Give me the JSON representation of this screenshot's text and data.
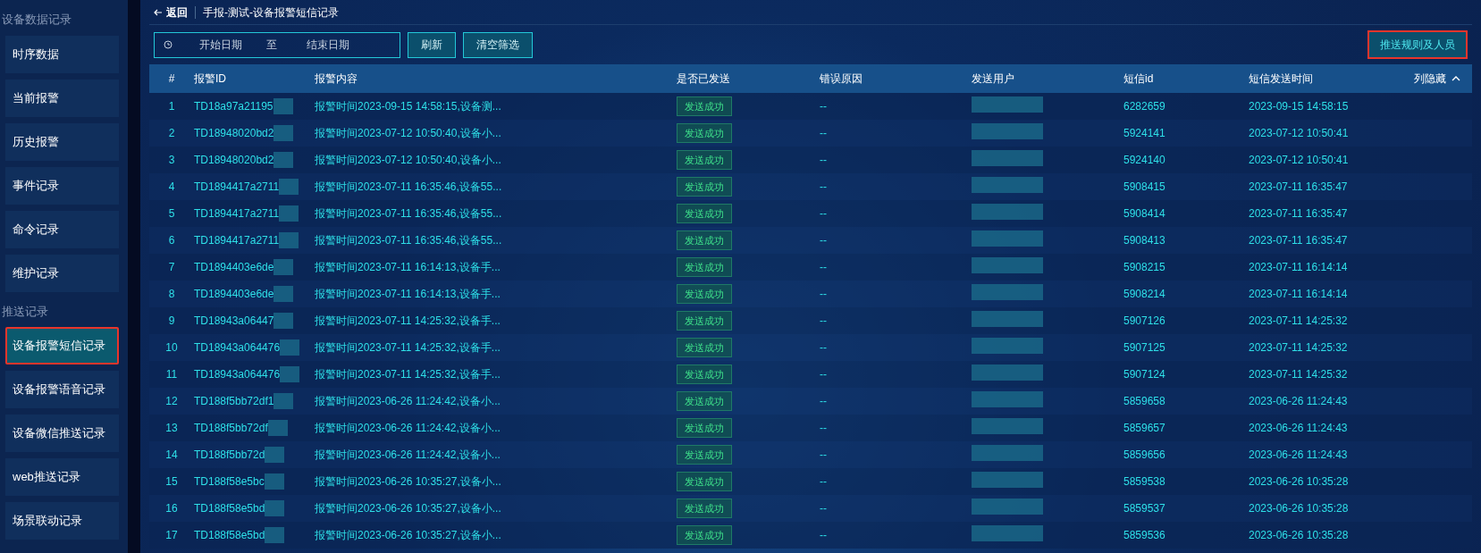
{
  "sidebar": {
    "sections": [
      {
        "title": "设备数据记录",
        "items": [
          {
            "label": "时序数据",
            "selected": false
          },
          {
            "label": "当前报警",
            "selected": false
          },
          {
            "label": "历史报警",
            "selected": false
          },
          {
            "label": "事件记录",
            "selected": false
          },
          {
            "label": "命令记录",
            "selected": false
          },
          {
            "label": "维护记录",
            "selected": false
          }
        ]
      },
      {
        "title": "推送记录",
        "items": [
          {
            "label": "设备报警短信记录",
            "selected": true
          },
          {
            "label": "设备报警语音记录",
            "selected": false
          },
          {
            "label": "设备微信推送记录",
            "selected": false
          },
          {
            "label": "web推送记录",
            "selected": false
          },
          {
            "label": "场景联动记录",
            "selected": false
          }
        ]
      }
    ]
  },
  "header": {
    "back": "返回",
    "breadcrumb": "手报-测试-设备报警短信记录"
  },
  "filters": {
    "start_placeholder": "开始日期",
    "separator": "至",
    "end_placeholder": "结束日期",
    "buttons": [
      "刷新",
      "清空筛选"
    ],
    "action": "推送规则及人员"
  },
  "table": {
    "columns": [
      "#",
      "报警ID",
      "报警内容",
      "是否已发送",
      "错误原因",
      "发送用户",
      "短信id",
      "短信发送时间"
    ],
    "column_toggle": "列隐藏",
    "rows": [
      {
        "index": "1",
        "alarm_id": "TD18a97a21195",
        "content": "报警时间2023-09-15 14:58:15,设备测...",
        "status": "发送成功",
        "error": "--",
        "sms_id": "6282659",
        "time": "2023-09-15 14:58:15"
      },
      {
        "index": "2",
        "alarm_id": "TD18948020bd2",
        "content": "报警时间2023-07-12 10:50:40,设备小...",
        "status": "发送成功",
        "error": "--",
        "sms_id": "5924141",
        "time": "2023-07-12 10:50:41"
      },
      {
        "index": "3",
        "alarm_id": "TD18948020bd2",
        "content": "报警时间2023-07-12 10:50:40,设备小...",
        "status": "发送成功",
        "error": "--",
        "sms_id": "5924140",
        "time": "2023-07-12 10:50:41"
      },
      {
        "index": "4",
        "alarm_id": "TD1894417a2711",
        "content": "报警时间2023-07-11 16:35:46,设备55...",
        "status": "发送成功",
        "error": "--",
        "sms_id": "5908415",
        "time": "2023-07-11 16:35:47"
      },
      {
        "index": "5",
        "alarm_id": "TD1894417a2711",
        "content": "报警时间2023-07-11 16:35:46,设备55...",
        "status": "发送成功",
        "error": "--",
        "sms_id": "5908414",
        "time": "2023-07-11 16:35:47"
      },
      {
        "index": "6",
        "alarm_id": "TD1894417a2711",
        "content": "报警时间2023-07-11 16:35:46,设备55...",
        "status": "发送成功",
        "error": "--",
        "sms_id": "5908413",
        "time": "2023-07-11 16:35:47"
      },
      {
        "index": "7",
        "alarm_id": "TD1894403e6de",
        "content": "报警时间2023-07-11 16:14:13,设备手...",
        "status": "发送成功",
        "error": "--",
        "sms_id": "5908215",
        "time": "2023-07-11 16:14:14"
      },
      {
        "index": "8",
        "alarm_id": "TD1894403e6de",
        "content": "报警时间2023-07-11 16:14:13,设备手...",
        "status": "发送成功",
        "error": "--",
        "sms_id": "5908214",
        "time": "2023-07-11 16:14:14"
      },
      {
        "index": "9",
        "alarm_id": "TD18943a06447",
        "content": "报警时间2023-07-11 14:25:32,设备手...",
        "status": "发送成功",
        "error": "--",
        "sms_id": "5907126",
        "time": "2023-07-11 14:25:32"
      },
      {
        "index": "10",
        "alarm_id": "TD18943a064476",
        "content": "报警时间2023-07-11 14:25:32,设备手...",
        "status": "发送成功",
        "error": "--",
        "sms_id": "5907125",
        "time": "2023-07-11 14:25:32"
      },
      {
        "index": "11",
        "alarm_id": "TD18943a064476",
        "content": "报警时间2023-07-11 14:25:32,设备手...",
        "status": "发送成功",
        "error": "--",
        "sms_id": "5907124",
        "time": "2023-07-11 14:25:32"
      },
      {
        "index": "12",
        "alarm_id": "TD188f5bb72df1",
        "content": "报警时间2023-06-26 11:24:42,设备小...",
        "status": "发送成功",
        "error": "--",
        "sms_id": "5859658",
        "time": "2023-06-26 11:24:43"
      },
      {
        "index": "13",
        "alarm_id": "TD188f5bb72df",
        "content": "报警时间2023-06-26 11:24:42,设备小...",
        "status": "发送成功",
        "error": "--",
        "sms_id": "5859657",
        "time": "2023-06-26 11:24:43"
      },
      {
        "index": "14",
        "alarm_id": "TD188f5bb72d",
        "content": "报警时间2023-06-26 11:24:42,设备小...",
        "status": "发送成功",
        "error": "--",
        "sms_id": "5859656",
        "time": "2023-06-26 11:24:43"
      },
      {
        "index": "15",
        "alarm_id": "TD188f58e5bc",
        "content": "报警时间2023-06-26 10:35:27,设备小...",
        "status": "发送成功",
        "error": "--",
        "sms_id": "5859538",
        "time": "2023-06-26 10:35:28"
      },
      {
        "index": "16",
        "alarm_id": "TD188f58e5bd",
        "content": "报警时间2023-06-26 10:35:27,设备小...",
        "status": "发送成功",
        "error": "--",
        "sms_id": "5859537",
        "time": "2023-06-26 10:35:28"
      },
      {
        "index": "17",
        "alarm_id": "TD188f58e5bd",
        "content": "报警时间2023-06-26 10:35:27,设备小...",
        "status": "发送成功",
        "error": "--",
        "sms_id": "5859536",
        "time": "2023-06-26 10:35:28"
      }
    ]
  }
}
